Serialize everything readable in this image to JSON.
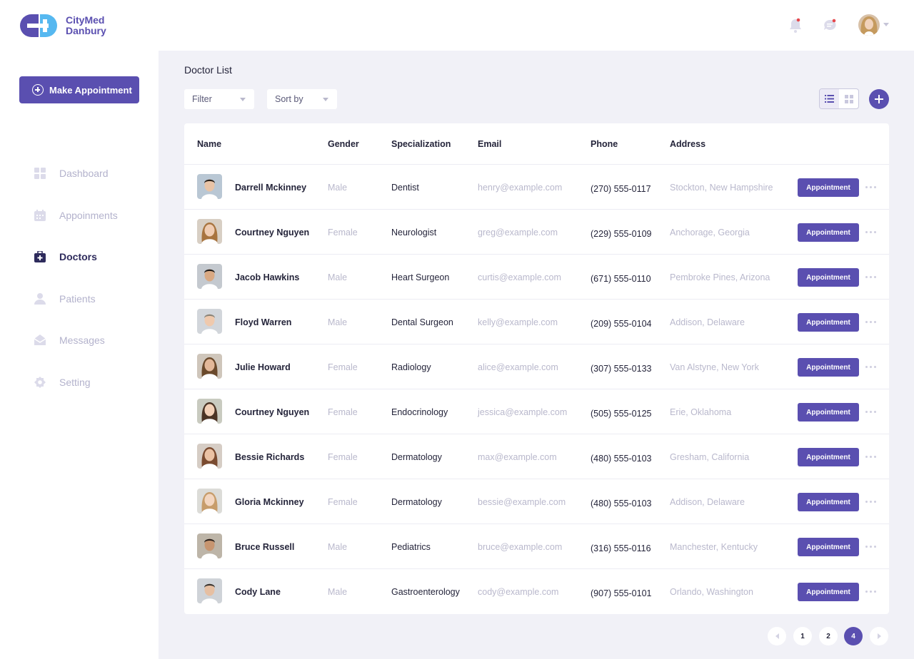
{
  "brand": {
    "line1": "CityMed",
    "line2": "Danbury"
  },
  "sidebar": {
    "make_appointment_label": "Make Appointment",
    "items": [
      {
        "label": "Dashboard",
        "icon": "grid-icon",
        "active": false
      },
      {
        "label": "Appoinments",
        "icon": "calendar-icon",
        "active": false
      },
      {
        "label": "Doctors",
        "icon": "medical-bag-icon",
        "active": true
      },
      {
        "label": "Patients",
        "icon": "person-icon",
        "active": false
      },
      {
        "label": "Messages",
        "icon": "envelope-icon",
        "active": false
      },
      {
        "label": "Setting",
        "icon": "gear-icon",
        "active": false
      }
    ]
  },
  "topbar": {
    "icons": [
      "bell-icon",
      "chat-icon"
    ],
    "notification_dot_color": "#e5484d"
  },
  "main": {
    "title": "Doctor List",
    "filter_label": "Filter",
    "sort_label": "Sort by"
  },
  "table": {
    "headers": {
      "name": "Name",
      "gender": "Gender",
      "specialization": "Specialization",
      "email": "Email",
      "phone": "Phone",
      "address": "Address"
    },
    "action_label": "Appointment",
    "rows": [
      {
        "name": "Darrell Mckinney",
        "gender": "Male",
        "specialization": "Dentist",
        "email": "henry@example.com",
        "phone": "(270) 555-0117",
        "address": "Stockton, New Hampshire"
      },
      {
        "name": "Courtney Nguyen",
        "gender": "Female",
        "specialization": "Neurologist",
        "email": "greg@example.com",
        "phone": "(229) 555-0109",
        "address": "Anchorage, Georgia"
      },
      {
        "name": "Jacob Hawkins",
        "gender": "Male",
        "specialization": "Heart Surgeon",
        "email": "curtis@example.com",
        "phone": "(671) 555-0110",
        "address": "Pembroke Pines, Arizona"
      },
      {
        "name": "Floyd Warren",
        "gender": "Male",
        "specialization": "Dental Surgeon",
        "email": "kelly@example.com",
        "phone": "(209) 555-0104",
        "address": "Addison, Delaware"
      },
      {
        "name": "Julie Howard",
        "gender": "Female",
        "specialization": "Radiology",
        "email": "alice@example.com",
        "phone": "(307) 555-0133",
        "address": "Van Alstyne, New York"
      },
      {
        "name": "Courtney Nguyen",
        "gender": "Female",
        "specialization": "Endocrinology",
        "email": "jessica@example.com",
        "phone": "(505) 555-0125",
        "address": "Erie, Oklahoma"
      },
      {
        "name": "Bessie Richards",
        "gender": "Female",
        "specialization": "Dermatology",
        "email": "max@example.com",
        "phone": "(480) 555-0103",
        "address": "Gresham, California"
      },
      {
        "name": "Gloria Mckinney",
        "gender": "Female",
        "specialization": "Dermatology",
        "email": "bessie@example.com",
        "phone": "(480) 555-0103",
        "address": "Addison, Delaware"
      },
      {
        "name": "Bruce Russell",
        "gender": "Male",
        "specialization": "Pediatrics",
        "email": "bruce@example.com",
        "phone": "(316) 555-0116",
        "address": "Manchester, Kentucky"
      },
      {
        "name": "Cody Lane",
        "gender": "Male",
        "specialization": "Gastroenterology",
        "email": "cody@example.com",
        "phone": "(907) 555-0101",
        "address": "Orlando, Washington"
      }
    ]
  },
  "pagination": {
    "pages": [
      "1",
      "2",
      "4"
    ],
    "current": "4"
  },
  "colors": {
    "accent": "#5a4fb0",
    "logo_light": "#56b8f0",
    "background": "#f1f1f7"
  }
}
